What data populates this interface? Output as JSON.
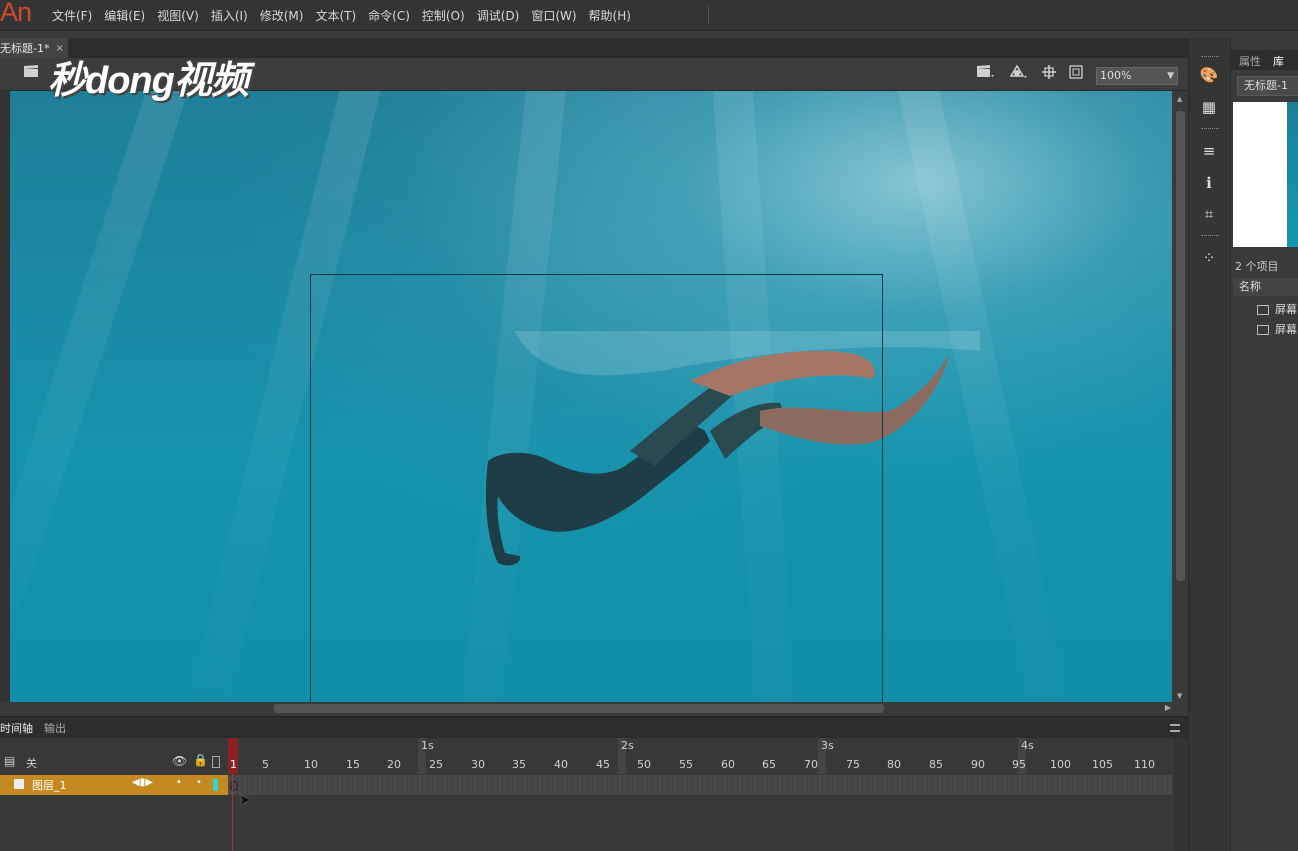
{
  "app": {
    "logo": "An"
  },
  "menu": [
    "文件(F)",
    "编辑(E)",
    "视图(V)",
    "插入(I)",
    "修改(M)",
    "文本(T)",
    "命令(C)",
    "控制(O)",
    "调试(D)",
    "窗口(W)",
    "帮助(H)"
  ],
  "document_tab": {
    "title": "无标题-1*",
    "close": "×"
  },
  "watermark": "秒dong视频",
  "toolbar": {
    "zoom": "100%"
  },
  "timeline": {
    "tabs": [
      "时间轴",
      "输出"
    ],
    "layer_header_label": "关",
    "layer_name": "图层_1",
    "seconds": [
      "1s",
      "2s",
      "3s",
      "4s"
    ],
    "frame_labels": [
      "1",
      "5",
      "10",
      "15",
      "20",
      "25",
      "30",
      "35",
      "40",
      "45",
      "50",
      "55",
      "60",
      "65",
      "70",
      "75",
      "80",
      "85",
      "90",
      "95",
      "100",
      "105",
      "110"
    ]
  },
  "panel": {
    "tabs": [
      "属性",
      "库"
    ],
    "document": "无标题-1",
    "item_count": "2 个项目",
    "column_name": "名称",
    "items": [
      "屏幕",
      "屏幕"
    ]
  }
}
